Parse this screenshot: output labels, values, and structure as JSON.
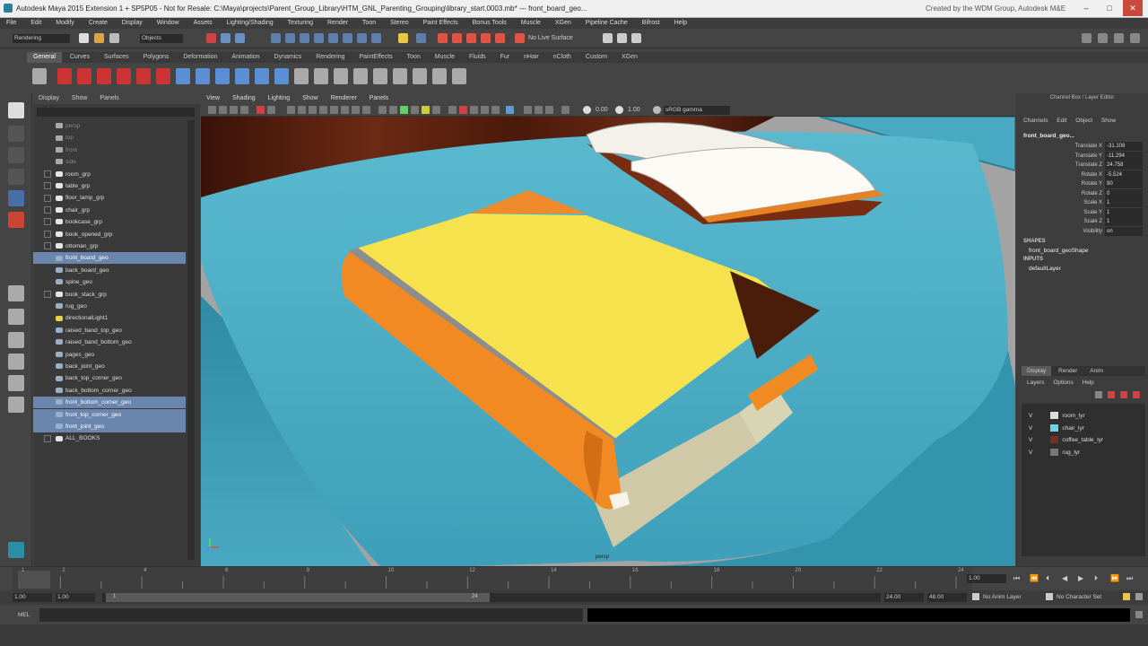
{
  "window": {
    "title": "Autodesk Maya 2015 Extension 1 + SP5P05 - Not for Resale: C:\\Maya\\projects\\Parent_Group_Library\\HTM_GNL_Parenting_Grouping\\library_start.0003.mb*   ---   front_board_geo...",
    "credit": "Created by the WDM Group, Autodesk M&E",
    "minimize": "–",
    "maximize": "□",
    "close": "✕"
  },
  "menubar": [
    "File",
    "Edit",
    "Modify",
    "Create",
    "Display",
    "Window",
    "Assets",
    "Lighting/Shading",
    "Texturing",
    "Render",
    "Toon",
    "Stereo",
    "Paint Effects",
    "Bonus Tools",
    "Muscle",
    "XGen",
    "Pipeline Cache",
    "Bifrost",
    "Help"
  ],
  "status": {
    "mode": "Rendering",
    "objects_label": "Objects",
    "live_surface": "No Live Surface"
  },
  "shelf_tabs": [
    "General",
    "Curves",
    "Surfaces",
    "Polygons",
    "Deformation",
    "Animation",
    "Dynamics",
    "Rendering",
    "PaintEffects",
    "Toon",
    "Muscle",
    "Fluids",
    "Fur",
    "nHair",
    "nCloth",
    "Custom",
    "XGen"
  ],
  "shelf_active": "General",
  "outliner": {
    "menu": [
      "Display",
      "Show",
      "Panels"
    ],
    "items": [
      {
        "label": "persp",
        "state": "dim",
        "icon": "camera"
      },
      {
        "label": "top",
        "state": "dim",
        "icon": "camera"
      },
      {
        "label": "front",
        "state": "dim",
        "icon": "camera"
      },
      {
        "label": "side",
        "state": "dim",
        "icon": "camera"
      },
      {
        "label": "room_grp",
        "state": "normal",
        "icon": "group"
      },
      {
        "label": "table_grp",
        "state": "normal",
        "icon": "group"
      },
      {
        "label": "floor_lamp_grp",
        "state": "normal",
        "icon": "group"
      },
      {
        "label": "chair_grp",
        "state": "normal",
        "icon": "group"
      },
      {
        "label": "bookcase_grp",
        "state": "normal",
        "icon": "group"
      },
      {
        "label": "book_opened_grp",
        "state": "normal",
        "icon": "group"
      },
      {
        "label": "ottoman_grp",
        "state": "normal",
        "icon": "group"
      },
      {
        "label": "front_board_geo",
        "state": "selected",
        "icon": "mesh"
      },
      {
        "label": "back_board_geo",
        "state": "normal",
        "icon": "mesh"
      },
      {
        "label": "spine_geo",
        "state": "normal",
        "icon": "mesh"
      },
      {
        "label": "book_stack_grp",
        "state": "normal",
        "icon": "group"
      },
      {
        "label": "rug_geo",
        "state": "normal",
        "icon": "mesh"
      },
      {
        "label": "directionalLight1",
        "state": "normal",
        "icon": "light"
      },
      {
        "label": "raised_band_top_geo",
        "state": "normal",
        "icon": "mesh"
      },
      {
        "label": "raised_band_bottom_geo",
        "state": "normal",
        "icon": "mesh"
      },
      {
        "label": "pages_geo",
        "state": "normal",
        "icon": "mesh"
      },
      {
        "label": "back_joint_geo",
        "state": "normal",
        "icon": "mesh"
      },
      {
        "label": "back_top_corner_geo",
        "state": "normal",
        "icon": "mesh"
      },
      {
        "label": "back_bottom_corner_geo",
        "state": "normal",
        "icon": "mesh"
      },
      {
        "label": "front_bottom_corner_geo",
        "state": "selected",
        "icon": "mesh"
      },
      {
        "label": "front_top_corner_geo",
        "state": "selected",
        "icon": "mesh"
      },
      {
        "label": "front_joint_geo",
        "state": "selected",
        "icon": "mesh"
      },
      {
        "label": "ALL_BOOKS",
        "state": "normal",
        "icon": "group"
      }
    ]
  },
  "viewport": {
    "menu": [
      "View",
      "Shading",
      "Lighting",
      "Show",
      "Renderer",
      "Panels"
    ],
    "field_a": "0.00",
    "field_b": "1.00",
    "color_space": "sRGB gamma",
    "camera_label": "persp"
  },
  "channel_box": {
    "header": "Channel Box / Layer Editor",
    "menu": [
      "Channels",
      "Edit",
      "Object",
      "Show"
    ],
    "object": "front_board_geo...",
    "channels": [
      {
        "name": "Translate X",
        "value": "-31.108"
      },
      {
        "name": "Translate Y",
        "value": "-11.294"
      },
      {
        "name": "Translate Z",
        "value": "24.758"
      },
      {
        "name": "Rotate X",
        "value": "-5.524"
      },
      {
        "name": "Rotate Y",
        "value": "90"
      },
      {
        "name": "Rotate Z",
        "value": "0"
      },
      {
        "name": "Scale X",
        "value": "1"
      },
      {
        "name": "Scale Y",
        "value": "1"
      },
      {
        "name": "Scale Z",
        "value": "1"
      },
      {
        "name": "Visibility",
        "value": "on"
      }
    ],
    "shapes_label": "SHAPES",
    "shape": "front_board_geoShape",
    "inputs_label": "INPUTS",
    "input": "defaultLayer",
    "layer_tabs": [
      "Display",
      "Render",
      "Anim"
    ],
    "layer_menu": [
      "Layers",
      "Options",
      "Help"
    ],
    "layers": [
      {
        "name": "room_lyr",
        "color": "#dddddd"
      },
      {
        "name": "chair_lyr",
        "color": "#6fd4e0"
      },
      {
        "name": "coffee_table_lyr",
        "color": "#7a3020"
      },
      {
        "name": "rug_lyr",
        "color": "#777777"
      }
    ],
    "visible_flag": "V"
  },
  "timeline": {
    "ticks": [
      "1",
      "2",
      "4",
      "6",
      "8",
      "10",
      "12",
      "14",
      "16",
      "18",
      "20",
      "22",
      "24"
    ],
    "current_frame": "1.00"
  },
  "range": {
    "start": "1.00",
    "playback_start": "1.00",
    "slider_start": "1",
    "slider_end": "24",
    "playback_end": "24.00",
    "end": "48.00",
    "anim_layer": "No Anim Layer",
    "character_set": "No Character Set"
  },
  "cmdline": {
    "label": "MEL"
  }
}
